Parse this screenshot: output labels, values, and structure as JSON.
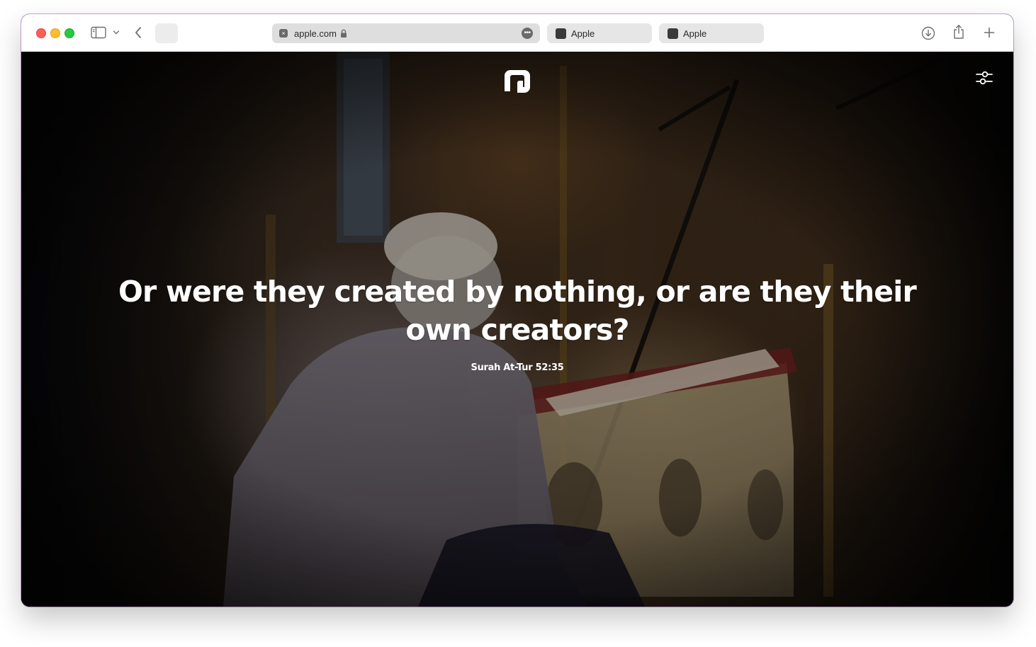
{
  "browser": {
    "address_url": "apple.com",
    "tabs": [
      {
        "label": "Apple"
      },
      {
        "label": "Apple"
      }
    ]
  },
  "page": {
    "quote": "Or were they created by nothing, or are they their own creators?",
    "reference": "Surah At-Tur 52:35"
  },
  "colors": {
    "quote_text": "#ffffff",
    "traffic_close": "#ff5f57",
    "traffic_minimize": "#febc2e",
    "traffic_maximize": "#28c840"
  },
  "icons": {
    "sidebar": "sidebar-icon",
    "chevron": "chevron-down-icon",
    "back": "chevron-left-icon",
    "lock": "lock-icon",
    "more": "ellipsis-icon",
    "download": "download-icon",
    "share": "share-icon",
    "new_tab": "plus-icon",
    "logo": "logo-icon",
    "settings": "sliders-icon"
  }
}
